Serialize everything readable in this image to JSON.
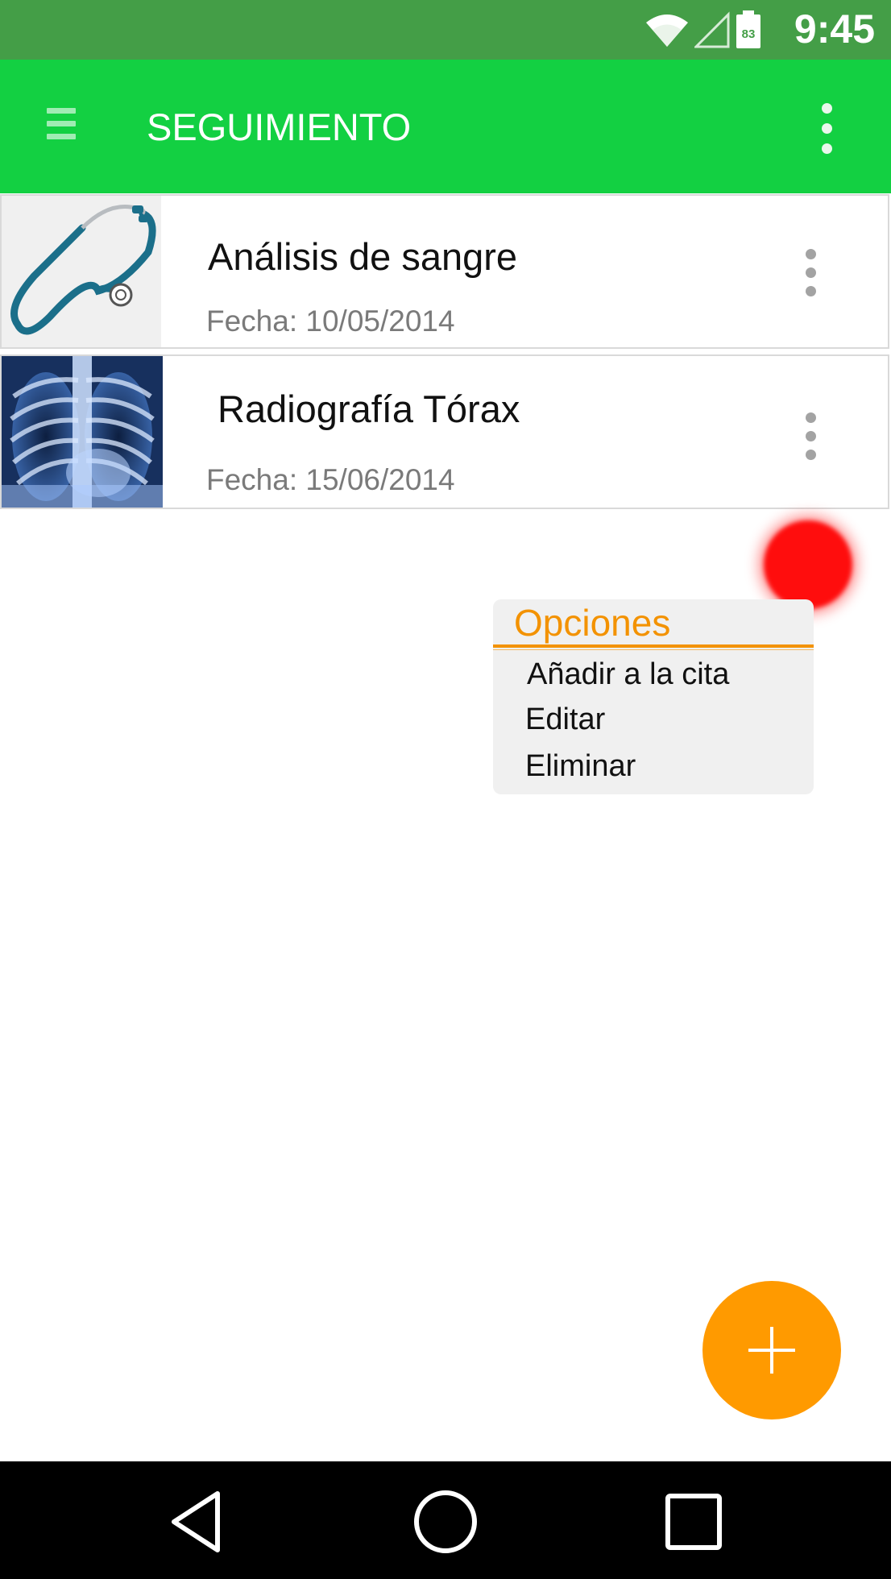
{
  "status_bar": {
    "time": "9:45",
    "battery_level": "83"
  },
  "app_bar": {
    "title": "SEGUIMIENTO"
  },
  "items": [
    {
      "title": "Análisis de sangre",
      "date": "Fecha: 10/05/2014",
      "thumbnail": "stethoscope"
    },
    {
      "title": "Radiografía Tórax",
      "date": "Fecha: 15/06/2014",
      "thumbnail": "chest-xray"
    }
  ],
  "options_menu": {
    "title": "Opciones",
    "items": [
      "Añadir a la cita",
      "Editar",
      "Eliminar"
    ]
  },
  "fab": {
    "icon": "plus-icon"
  },
  "colors": {
    "status_bar": "#449e47",
    "app_bar": "#13d042",
    "accent": "#ff9a00",
    "menu_title": "#f39200",
    "touch_indicator": "#ff0d0d"
  }
}
